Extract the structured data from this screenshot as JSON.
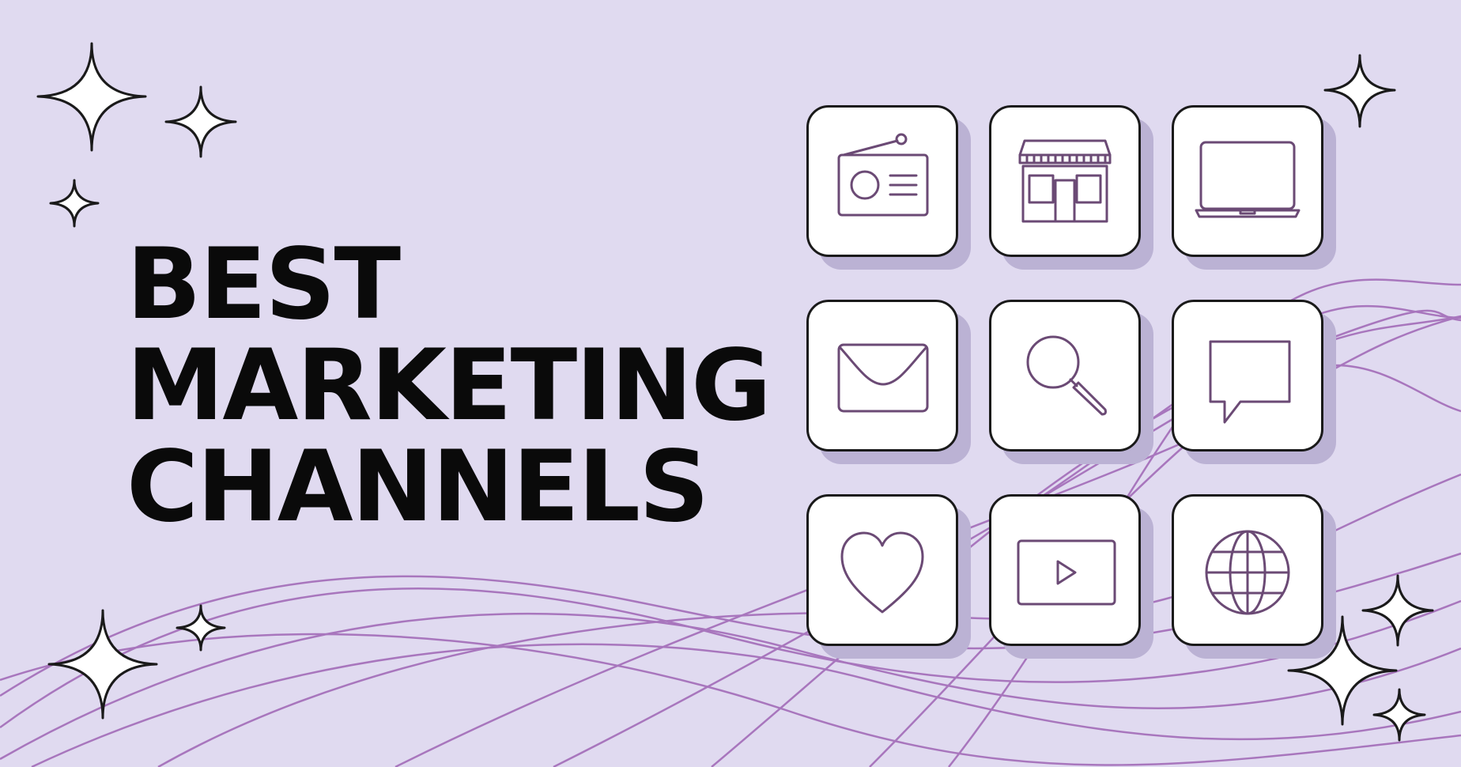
{
  "headline": {
    "lines": [
      "BEST",
      "MARKETING",
      "CHANNELS"
    ]
  },
  "colors": {
    "background": "#e0daf0",
    "wave": "#a876bd",
    "icon_stroke": "#6b4a75",
    "tile_shadow": "#bbb2d4",
    "text": "#0a0a0a"
  },
  "channels": [
    {
      "icon": "radio-icon"
    },
    {
      "icon": "storefront-icon"
    },
    {
      "icon": "laptop-icon"
    },
    {
      "icon": "envelope-icon"
    },
    {
      "icon": "magnifier-icon"
    },
    {
      "icon": "speech-bubble-icon"
    },
    {
      "icon": "heart-icon"
    },
    {
      "icon": "video-play-icon"
    },
    {
      "icon": "globe-icon"
    }
  ]
}
